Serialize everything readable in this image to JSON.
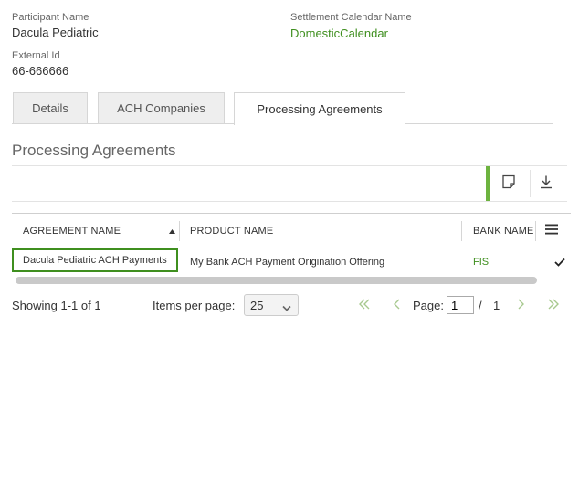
{
  "participant": {
    "name_label": "Participant Name",
    "name_value": "Dacula Pediatric",
    "external_id_label": "External Id",
    "external_id_value": "66-666666",
    "calendar_label": "Settlement Calendar Name",
    "calendar_value": "DomesticCalendar"
  },
  "tabs": [
    {
      "label": "Details"
    },
    {
      "label": "ACH Companies"
    },
    {
      "label": "Processing Agreements",
      "active": true
    }
  ],
  "section_title": "Processing Agreements",
  "toolbar": {
    "icons": [
      "note-icon",
      "download-icon"
    ]
  },
  "grid": {
    "columns": [
      "AGREEMENT NAME",
      "PRODUCT NAME",
      "BANK NAME"
    ],
    "sort": {
      "column": "AGREEMENT NAME",
      "direction": "ascending"
    },
    "rows": [
      {
        "agreement_name": "Dacula Pediatric ACH Payments",
        "product_name": "My Bank ACH Payment Origination Offering",
        "bank_name": "FIS",
        "selected": true
      }
    ]
  },
  "pager": {
    "showing": "Showing 1-1 of 1",
    "items_per_page_label": "Items per page:",
    "items_per_page_value": "25",
    "page_label": "Page:",
    "page_value": "1",
    "separator": "/",
    "total_pages": "1"
  },
  "colors": {
    "accent": "#6db33f",
    "link": "#3f8f1f",
    "disabled_nav": "#a8c98f"
  }
}
